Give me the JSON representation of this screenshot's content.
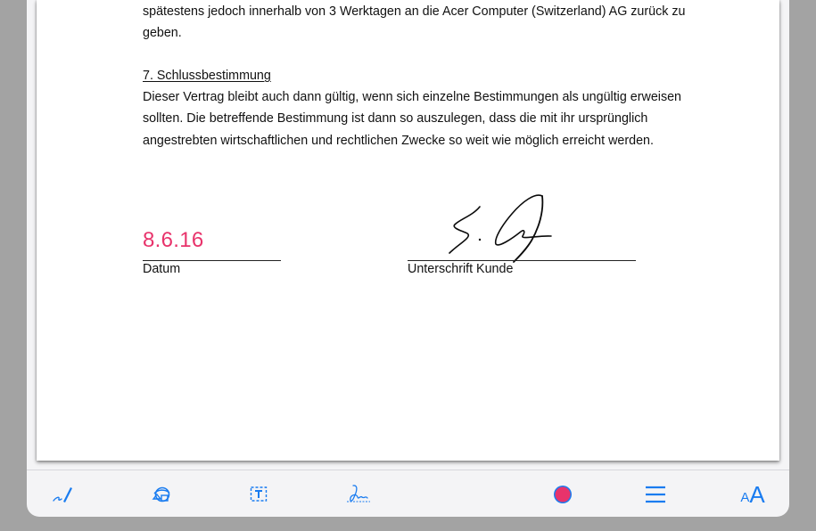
{
  "document": {
    "lines": [
      "spätestens jedoch innerhalb von 3 Werktagen an die Acer Computer (Switzerland) AG zurück zu",
      "geben."
    ],
    "section_heading": "7. Schlussbestimmung",
    "section_lines": [
      "Dieser Vertrag bleibt auch dann gültig, wenn sich einzelne Bestimmungen als ungültig erweisen",
      "sollten. Die betreffende Bestimmung ist dann so auszulegen, dass die mit ihr ursprünglich",
      "angestrebten wirtschaftlichen und rechtlichen Zwecke so weit wie möglich erreicht werden."
    ],
    "date_value": "8.6.16",
    "date_caption": "Datum",
    "signature_caption": "Unterschrift Kunde"
  },
  "toolbar": {
    "tools": [
      {
        "name": "pen-tool",
        "icon": "pen-icon"
      },
      {
        "name": "shapes-tool",
        "icon": "shapes-icon"
      },
      {
        "name": "text-tool",
        "icon": "text-box-icon"
      },
      {
        "name": "signature-tool",
        "icon": "signature-icon"
      },
      {
        "name": "color-picker",
        "icon": "color-dot-icon"
      },
      {
        "name": "line-width",
        "icon": "lines-icon"
      },
      {
        "name": "font-size",
        "icon": "font-size-icon"
      }
    ],
    "font_size_small": "A",
    "font_size_large": "A",
    "accent_color": "#1a7cf0",
    "selected_color": "#e8336b"
  }
}
